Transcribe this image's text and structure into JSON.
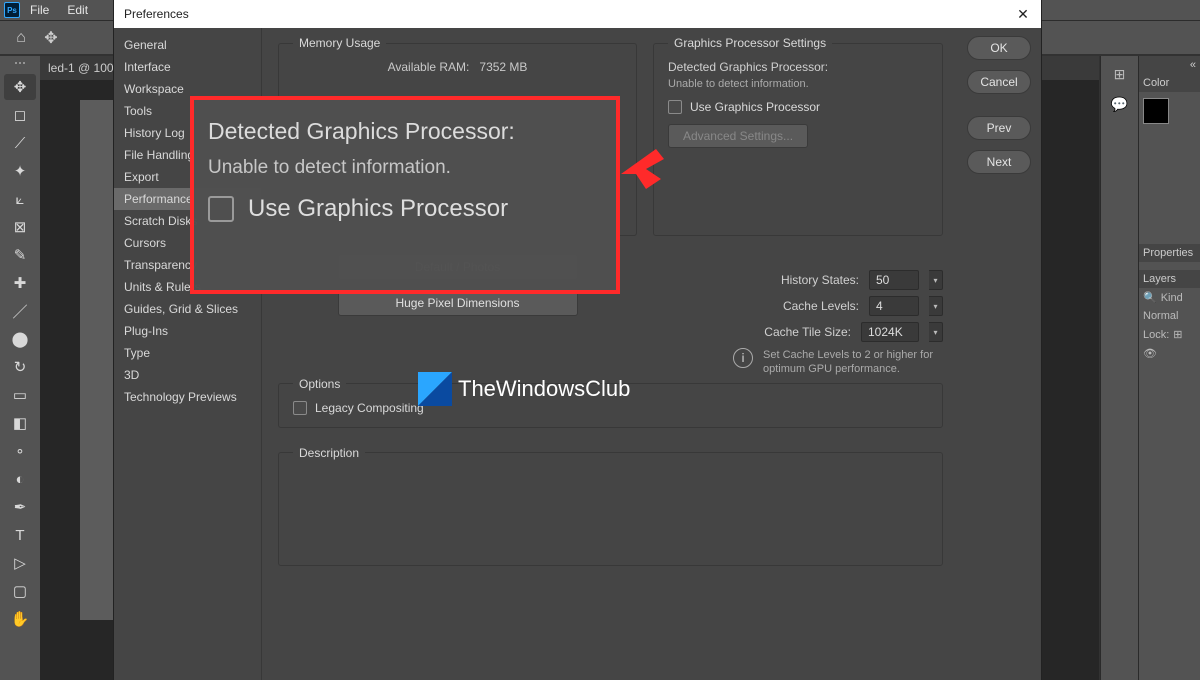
{
  "menubar": {
    "ps": "Ps",
    "file": "File",
    "edit": "Edit"
  },
  "doc_tab": "led-1 @ 100",
  "dialog": {
    "title": "Preferences",
    "categories": [
      "General",
      "Interface",
      "Workspace",
      "Tools",
      "History Log",
      "File Handling",
      "Export",
      "Performance",
      "Scratch Disks",
      "Cursors",
      "Transparency",
      "Units & Rulers",
      "Guides, Grid & Slices",
      "Plug-Ins",
      "Type",
      "3D",
      "Technology Previews"
    ],
    "selected_category": "Performance",
    "buttons": {
      "ok": "OK",
      "cancel": "Cancel",
      "prev": "Prev",
      "next": "Next"
    },
    "memory": {
      "legend": "Memory Usage",
      "available_label": "Available RAM:",
      "available_value": "7352 MB"
    },
    "gpu": {
      "legend": "Graphics Processor Settings",
      "detected_label": "Detected Graphics Processor:",
      "detected_value": "Unable to detect information.",
      "use_gpu": "Use Graphics Processor",
      "advanced": "Advanced Settings..."
    },
    "history": {
      "states_label": "History States:",
      "states_value": "50",
      "levels_label": "Cache Levels:",
      "levels_value": "4",
      "tile_label": "Cache Tile Size:",
      "tile_value": "1024K",
      "help": "Set Cache Levels to 2 or higher for optimum GPU performance."
    },
    "presets": {
      "default": "Default / Photos",
      "huge": "Huge Pixel Dimensions"
    },
    "options": {
      "legend": "Options",
      "legacy": "Legacy Compositing"
    },
    "description": {
      "legend": "Description"
    }
  },
  "callout": {
    "heading": "Detected Graphics Processor:",
    "sub": "Unable to detect information.",
    "checkbox": "Use Graphics Processor"
  },
  "rightpanel": {
    "collapse": "«",
    "color": "Color",
    "properties": "Properties",
    "layers": "Layers",
    "kind": "Kind",
    "normal": "Normal",
    "lock": "Lock:"
  },
  "watermark": "TheWindowsClub",
  "icons": {
    "search": "🔍"
  }
}
